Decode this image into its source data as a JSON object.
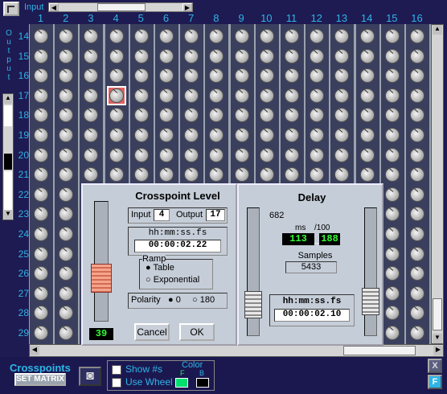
{
  "header": {
    "input_label": "Input",
    "columns": [
      "1",
      "2",
      "3",
      "4",
      "5",
      "6",
      "7",
      "8",
      "9",
      "10",
      "11",
      "12",
      "13",
      "14",
      "15",
      "16"
    ]
  },
  "sidebar": {
    "output_label": "Output",
    "rows": [
      "14",
      "15",
      "16",
      "17",
      "18",
      "19",
      "20",
      "21",
      "22",
      "23",
      "24",
      "25",
      "26",
      "27",
      "28",
      "29"
    ]
  },
  "crosspoint": {
    "title": "Crosspoint Level",
    "input_label": "Input",
    "input_value": "4",
    "output_label": "Output",
    "output_value": "17",
    "time_format": "hh:mm:ss.fs",
    "time_value": "00:00:02.22",
    "ramp_label": "Ramp",
    "ramp_table": "Table",
    "ramp_exponential": "Exponential",
    "polarity_label": "Polarity",
    "polarity_0": "0",
    "polarity_180": "180",
    "level_display": "39",
    "cancel_label": "Cancel",
    "ok_label": "OK"
  },
  "delay": {
    "title": "Delay",
    "value_682": "682",
    "ms_label": "ms",
    "per100_label": "/100",
    "ms_value": "113",
    "hundredths_value": "188",
    "samples_label": "Samples",
    "samples_value": "5433",
    "time_format": "hh:mm:ss.fs",
    "time_value": "00:00:02.10"
  },
  "footer": {
    "title": "Crosspoints",
    "set_matrix": "SET MATRIX",
    "show_numbers": "Show #s",
    "use_wheel": "Use Wheel",
    "color_label": "Color",
    "color_f": "F",
    "color_b": "B",
    "close_x": "X",
    "float_f": "F"
  },
  "colors": {
    "accent": "#2fb5e6",
    "selected": "#e06060",
    "lcd": "#33ff33",
    "fg_swatch": "#00e070",
    "bg_swatch": "#000000"
  }
}
